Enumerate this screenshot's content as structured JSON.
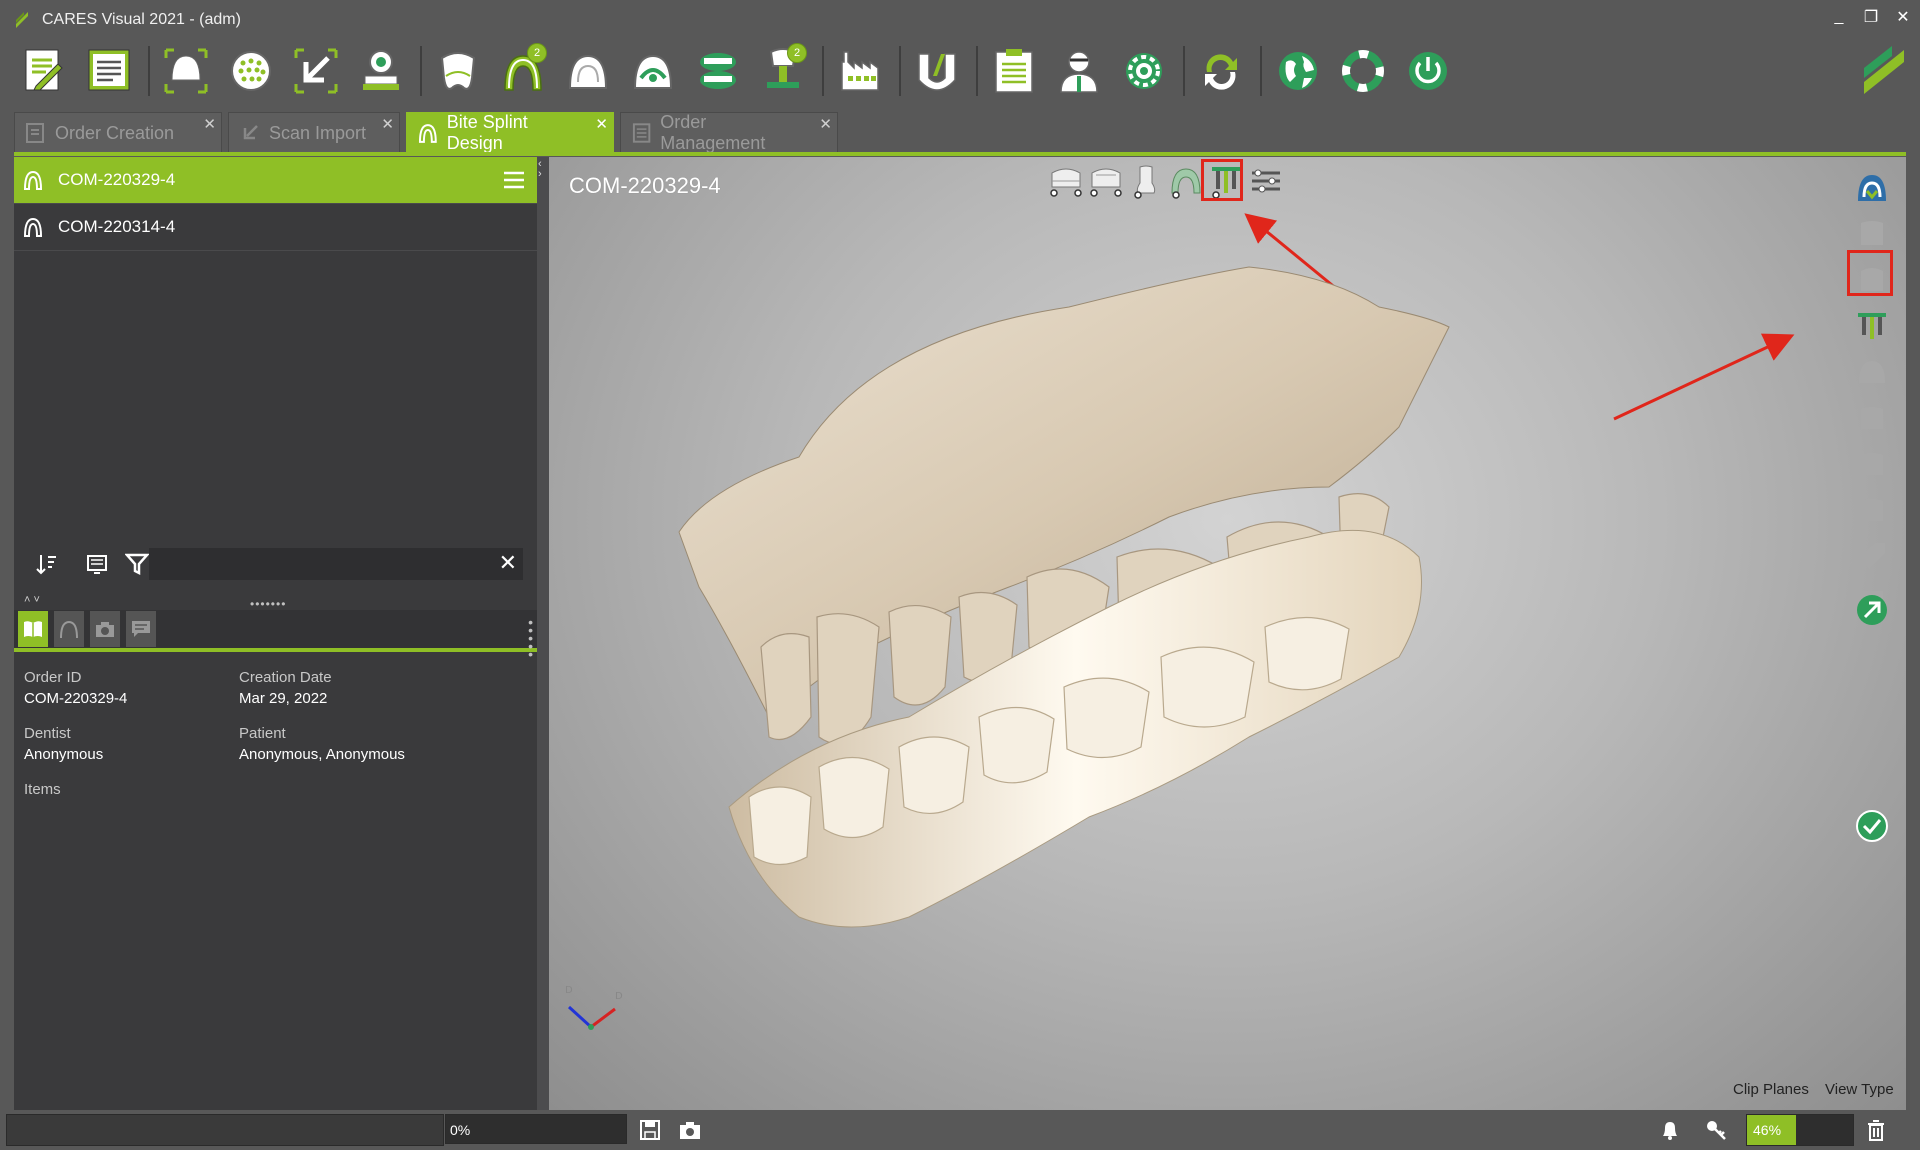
{
  "window": {
    "title": "CARES Visual 2021 - (adm)",
    "controls": [
      "_",
      "❐",
      "✕"
    ]
  },
  "toolbar": {
    "groups": [
      [
        "new-order",
        "order-form"
      ],
      [
        "scan-model",
        "scan-dots",
        "scan-import",
        "scan-stamp"
      ],
      [
        "crown",
        "bite-splint-2",
        "denture",
        "partial",
        "dentures-both",
        "implant-2"
      ],
      [
        "production"
      ],
      [
        "milling"
      ],
      [
        "report",
        "support-user",
        "settings"
      ],
      [
        "sync"
      ],
      [
        "web",
        "help",
        "power"
      ]
    ],
    "badges": {
      "bite-splint-2": "2",
      "implant-2": "2"
    }
  },
  "tabs": [
    {
      "label": "Order Creation",
      "active": false
    },
    {
      "label": "Scan Import",
      "active": false
    },
    {
      "label": "Bite Splint Design",
      "active": true
    },
    {
      "label": "Order Management",
      "active": false
    }
  ],
  "orders": [
    {
      "id": "COM-220329-4",
      "selected": true
    },
    {
      "id": "COM-220314-4",
      "selected": false
    }
  ],
  "filter": {
    "value": "",
    "placeholder": ""
  },
  "splitter_dots": "•••••••",
  "details": {
    "order_id_label": "Order ID",
    "order_id": "COM-220329-4",
    "creation_date_label": "Creation Date",
    "creation_date": "Mar 29, 2022",
    "dentist_label": "Dentist",
    "dentist": "Anonymous",
    "patient_label": "Patient",
    "patient": "Anonymous, Anonymous",
    "items_label": "Items"
  },
  "viewport": {
    "title": "COM-220329-4",
    "clip_planes": "Clip Planes",
    "view_type": "View Type",
    "axis_labels": {
      "top": "D",
      "right": "D"
    }
  },
  "status": {
    "progress_text": "0%",
    "progress": 0,
    "zoom_text": "46%",
    "zoom": 0.46
  },
  "colors": {
    "accent": "#8fbf26",
    "highlight": "#e0261b",
    "model": "#e6d8c4"
  }
}
